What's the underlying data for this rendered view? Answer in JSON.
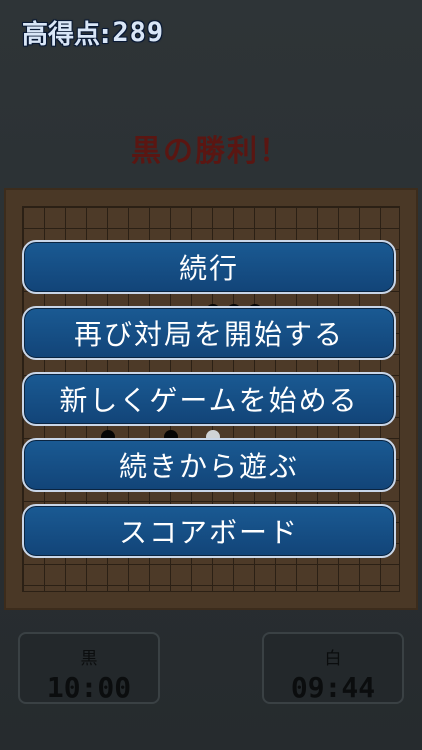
{
  "header": {
    "high_score_label": "高得点:",
    "high_score_value": "289"
  },
  "result_text": "黒の勝利！",
  "menu": {
    "items": [
      {
        "label": "続行"
      },
      {
        "label": "再び対局を開始する"
      },
      {
        "label": "新しくゲームを始める"
      },
      {
        "label": "続きから遊ぶ"
      },
      {
        "label": "スコアボード"
      }
    ]
  },
  "timers": {
    "black": {
      "label": "黒",
      "time": "10:00"
    },
    "white": {
      "label": "白",
      "time": "09:44"
    }
  },
  "colors": {
    "button_fill": "#1a5a93",
    "button_border": "#c9d6e8",
    "result_text": "#5a1612",
    "board": "#4a3826"
  }
}
